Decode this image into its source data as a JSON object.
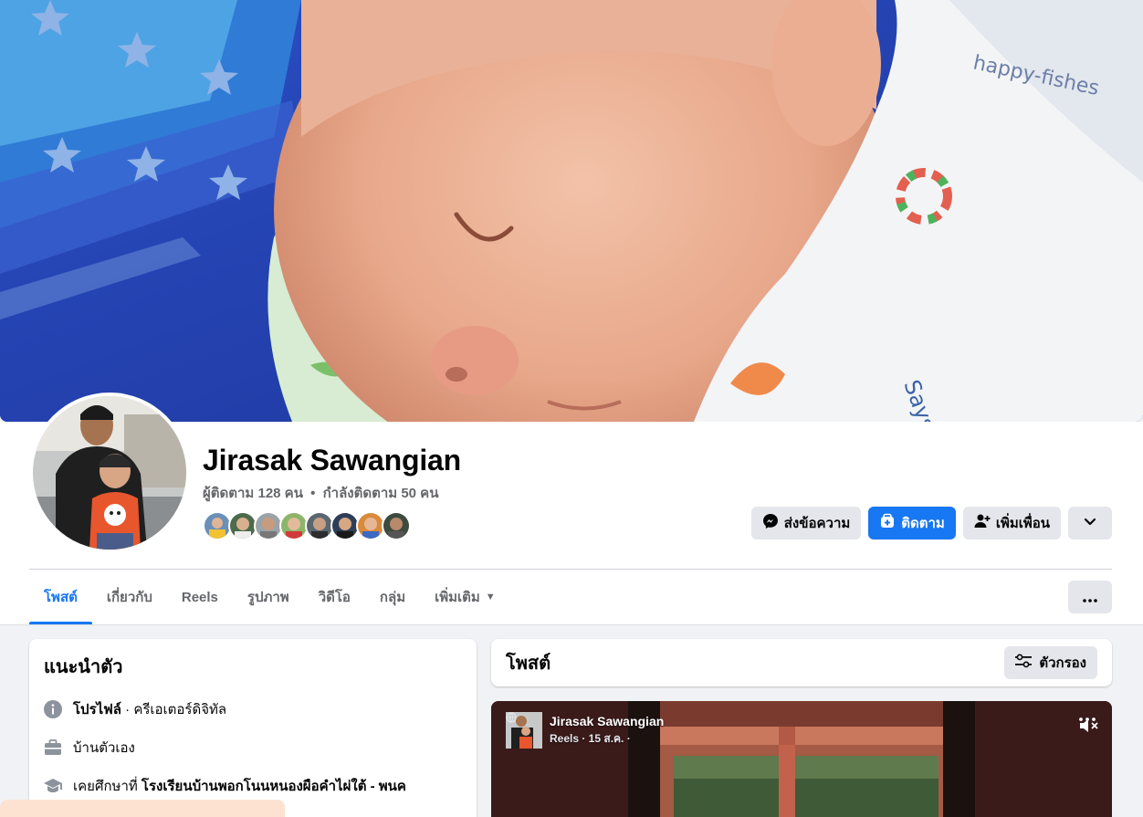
{
  "profile": {
    "name": "Jirasak Sawangian",
    "followers_text": "ผู้ติดตาม 128 คน",
    "separator": "•",
    "following_text": "กำลังติดตาม 50 คน",
    "friend_avatar_count": 8
  },
  "actions": {
    "message_label": "ส่งข้อความ",
    "follow_label": "ติดตาม",
    "add_friend_label": "เพิ่มเพื่อน"
  },
  "tabs": [
    {
      "label": "โพสต์",
      "active": true
    },
    {
      "label": "เกี่ยวกับ"
    },
    {
      "label": "Reels"
    },
    {
      "label": "รูปภาพ"
    },
    {
      "label": "วิดีโอ"
    },
    {
      "label": "กลุ่ม"
    },
    {
      "label": "เพิ่มเติม"
    }
  ],
  "intro": {
    "title": "แนะนำตัว",
    "profile_label": "โปรไฟล์",
    "profile_detail": " · ครีเอเตอร์ดิจิทัล",
    "hometown": "บ้านตัวเอง",
    "education_prefix": "เคยศึกษาที่ ",
    "education_school": "โรงเรียนบ้านพอกโนนหนองผือคำไผ่ใต้ - พนค"
  },
  "posts": {
    "title": "โพสต์",
    "filter_label": "ตัวกรอง"
  },
  "reel": {
    "author": "Jirasak Sawangian",
    "meta": "Reels · 15 ส.ค. ·"
  },
  "colors": {
    "brand_blue": "#1877f2",
    "button_grey": "#e4e6eb",
    "secondary_text": "#65676b",
    "page_bg": "#f0f2f5"
  }
}
